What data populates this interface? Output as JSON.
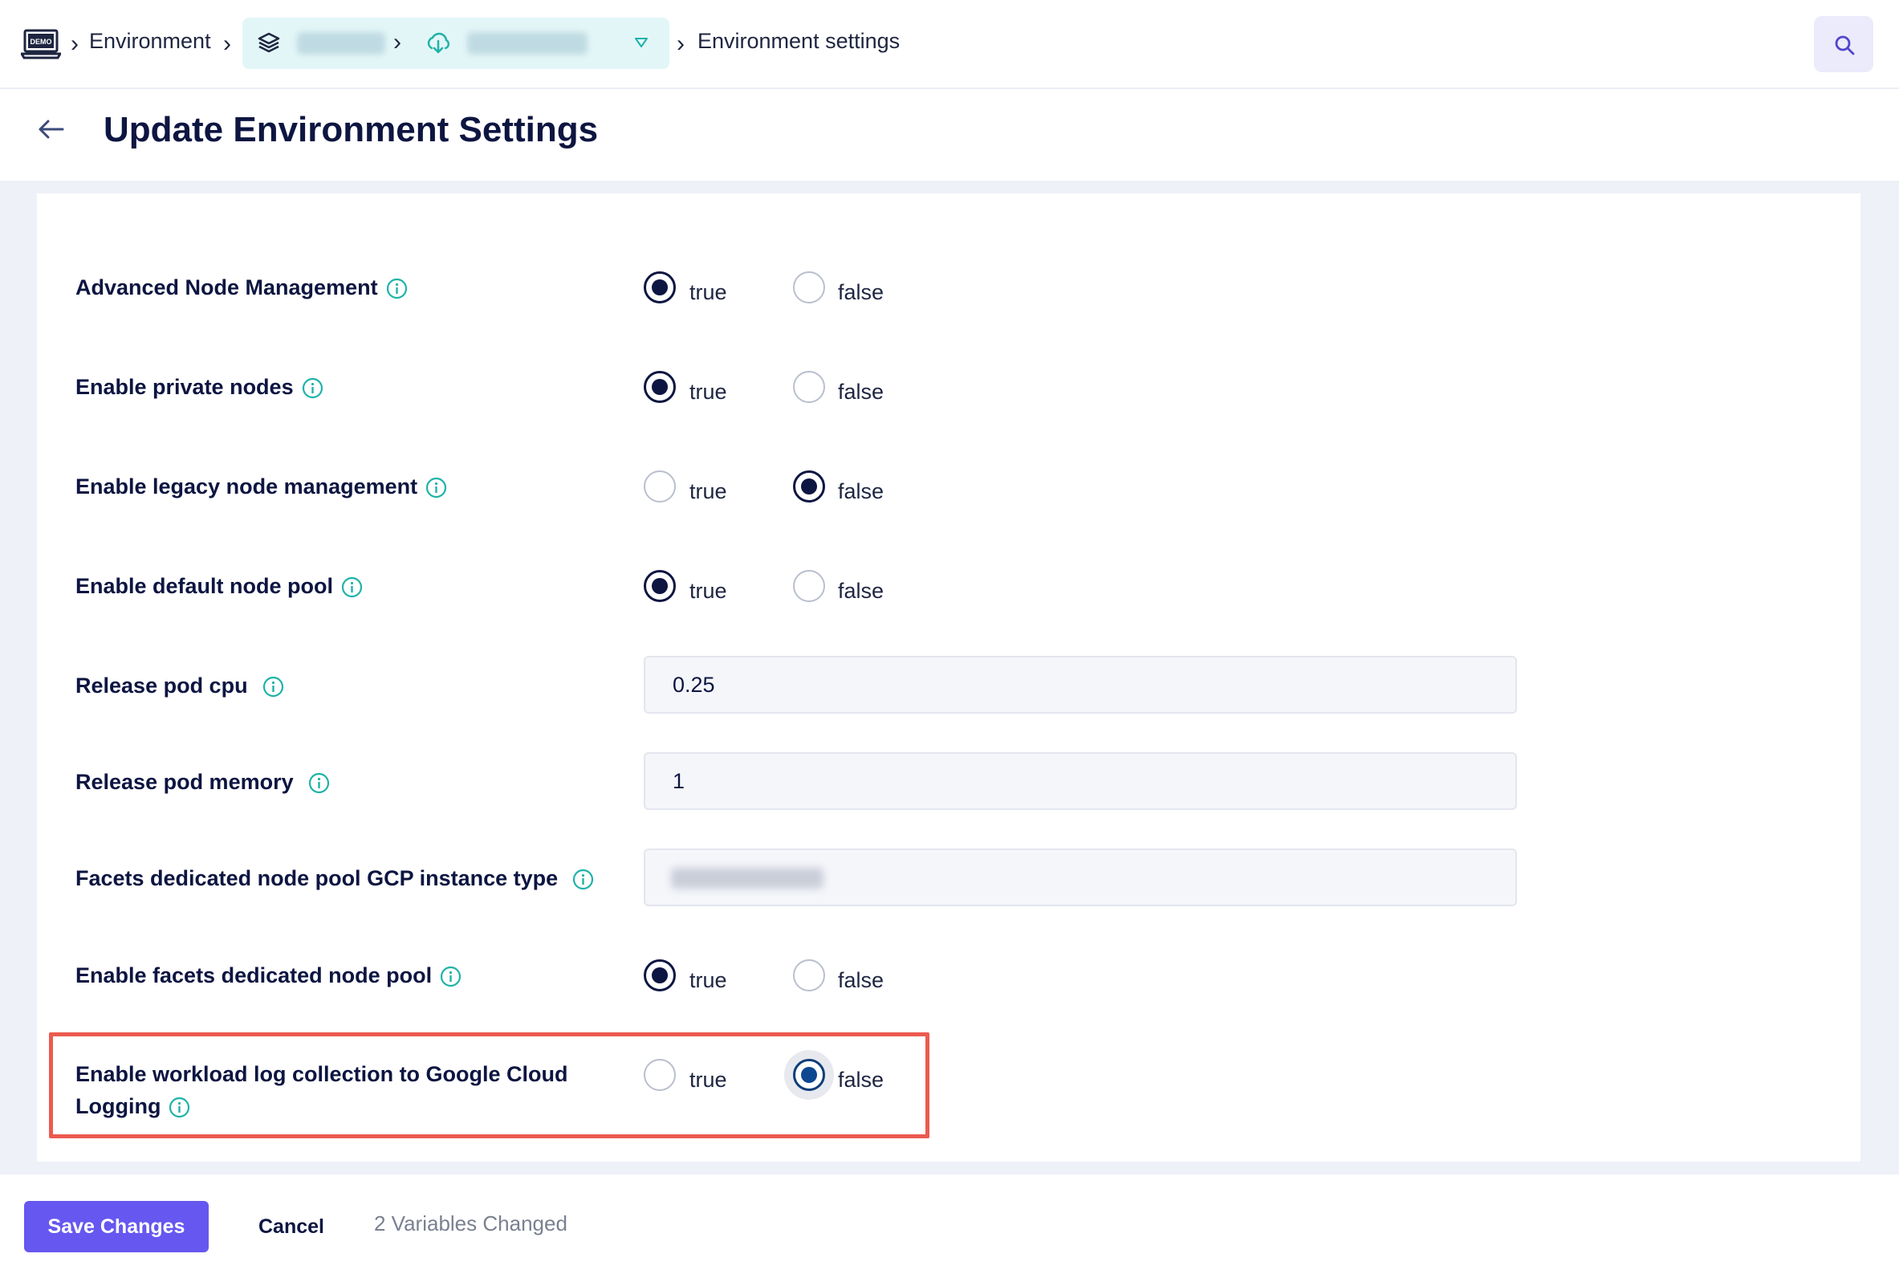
{
  "header": {
    "logo_text": "DEMO",
    "breadcrumb": {
      "environment": "Environment",
      "current": "Environment settings"
    }
  },
  "page": {
    "title": "Update Environment Settings"
  },
  "radio_options": {
    "true_label": "true",
    "false_label": "false"
  },
  "settings": {
    "advanced_node_management": {
      "label": "Advanced Node Management",
      "value": "true"
    },
    "enable_private_nodes": {
      "label": "Enable private nodes",
      "value": "true"
    },
    "enable_legacy_node_management": {
      "label": "Enable legacy node management",
      "value": "false"
    },
    "enable_default_node_pool": {
      "label": "Enable default node pool",
      "value": "true"
    },
    "release_pod_cpu": {
      "label": "Release pod cpu",
      "value": "0.25"
    },
    "release_pod_memory": {
      "label": "Release pod memory",
      "value": "1"
    },
    "facets_instance_type": {
      "label": "Facets dedicated node pool GCP instance type"
    },
    "enable_facets_dedicated_node_pool": {
      "label": "Enable facets dedicated node pool",
      "value": "true"
    },
    "enable_workload_log_collection": {
      "label": "Enable workload log collection to Google Cloud Logging",
      "value": "false"
    }
  },
  "footer": {
    "save_label": "Save Changes",
    "cancel_label": "Cancel",
    "changed_text": "2 Variables Changed"
  },
  "colors": {
    "accent": "#6657f0",
    "teal_icon": "#1fb3a8",
    "highlight": "#ec5a4f",
    "dark_text": "#0d1541"
  }
}
